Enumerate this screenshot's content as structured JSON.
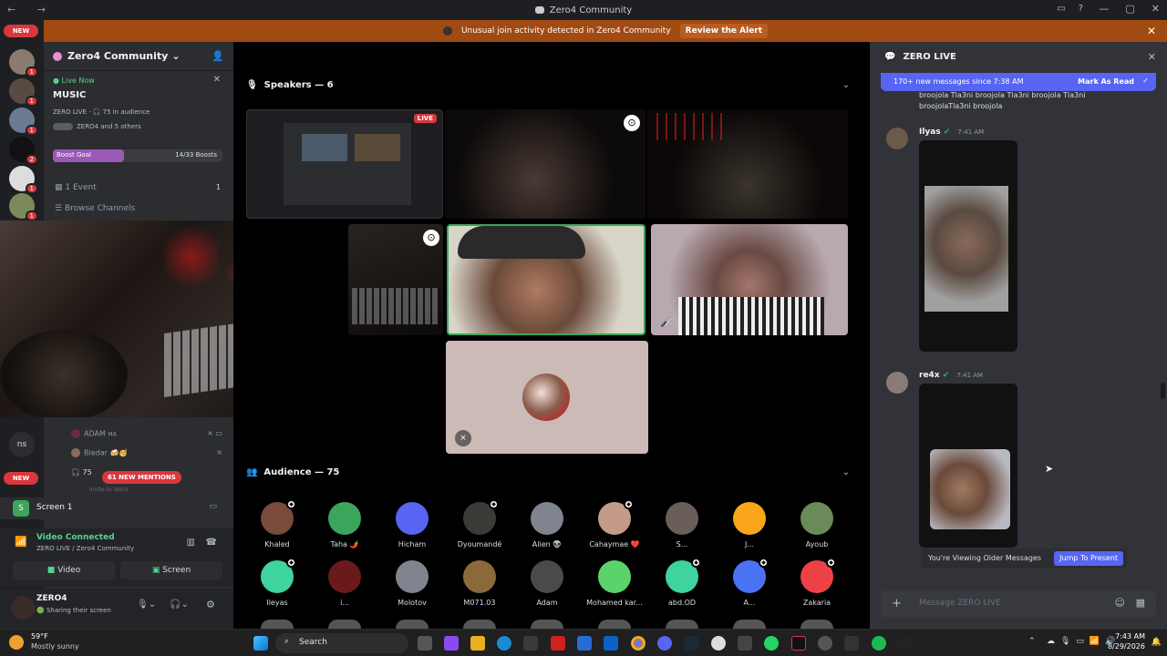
{
  "titlebar": {
    "title": "Zero4 Community"
  },
  "alert": {
    "text": "Unusual join activity detected in Zero4 Community",
    "action": "Review the Alert"
  },
  "rail": {
    "new_top": "NEW",
    "new_bottom": "NEW",
    "ns_label": "ns",
    "badges": [
      "1",
      "1",
      "1",
      "2",
      "1",
      "1"
    ]
  },
  "sidebar": {
    "server_name": "Zero4 Community",
    "live_now": "Live Now",
    "stage_title": "MUSIC",
    "stage_info": "ZERO LIVE · 🎧 75 in audience",
    "stage_others": "ZERO4 and 5 others",
    "boost_label": "Boost Goal",
    "boost_count": "14/33 Boosts",
    "boost_progress": 0.42,
    "event_label": "1 Event",
    "event_count": "1",
    "browse_label": "Browse Channels",
    "voice_users": [
      {
        "name": "ADAM",
        "tag": "MA"
      },
      {
        "name": "Biedar 🍻🥳",
        "tag": ""
      }
    ],
    "audience_count": "75",
    "mentions": "61 NEW MENTIONS",
    "invite_text": "Invite to Voice",
    "screen_label": "Screen 1"
  },
  "voice": {
    "status": "Video Connected",
    "channel": "ZERO LIVE / Zero4 Community",
    "video_btn": "Video",
    "screen_btn": "Screen"
  },
  "user": {
    "name": "ZERO4",
    "status": "Sharing their screen"
  },
  "stage": {
    "speakers_header": "Speakers — 6",
    "audience_header": "Audience — 75",
    "live_badge": "LIVE",
    "audience": [
      {
        "name": "Khaled",
        "color": "#7a4a3a",
        "hand": true
      },
      {
        "name": "Taha 🌶️",
        "color": "#3ba55c",
        "hand": false
      },
      {
        "name": "Hicham",
        "color": "#5865f2",
        "hand": false
      },
      {
        "name": "Dyoumandé",
        "color": "#3c3a36",
        "hand": true
      },
      {
        "name": "Alien 👽",
        "color": "#80848e",
        "hand": false
      },
      {
        "name": "Cahaymae ❤️",
        "color": "#c49a8a",
        "hand": true
      },
      {
        "name": "S...",
        "color": "#6a5e58",
        "hand": false
      },
      {
        "name": "J...",
        "color": "#faa61a",
        "hand": false
      },
      {
        "name": "Ayoub",
        "color": "#6a8a5a",
        "hand": false
      },
      {
        "name": "Ileyas",
        "color": "#3fd39d",
        "hand": true
      },
      {
        "name": "i...",
        "color": "#6a1a1a",
        "hand": false
      },
      {
        "name": "Molotov",
        "color": "#80848e",
        "hand": false
      },
      {
        "name": "M071.03",
        "color": "#8a6a3a",
        "hand": false
      },
      {
        "name": "Adam",
        "color": "#4a4a48",
        "hand": false
      },
      {
        "name": "Mohamed kar...",
        "color": "#5bd36a",
        "hand": false
      },
      {
        "name": "abd.OD",
        "color": "#3fd39d",
        "hand": true
      },
      {
        "name": "A...",
        "color": "#4a72f2",
        "hand": true
      },
      {
        "name": "Zakaria",
        "color": "#ed4245",
        "hand": true
      }
    ]
  },
  "chat": {
    "title": "ZERO LIVE",
    "new_messages": "170+ new messages since 7:38 AM",
    "mark_read": "Mark As Read",
    "top_text_1": "broojola Tla3ni broojola Tla3ni broojola Tla3ni",
    "top_text_2": "broojolaTla3ni broojola",
    "messages": [
      {
        "author": "Ilyas",
        "time": "7:41 AM"
      },
      {
        "author": "re4x",
        "time": "7:41 AM"
      }
    ],
    "older_text": "You're Viewing Older Messages",
    "jump_label": "Jump To Present",
    "placeholder": "Message ZERO LIVE"
  },
  "taskbar": {
    "temp": "59°F",
    "weather": "Mostly sunny",
    "search": "Search",
    "time": "7:43 AM",
    "date": "8/29/2026"
  }
}
